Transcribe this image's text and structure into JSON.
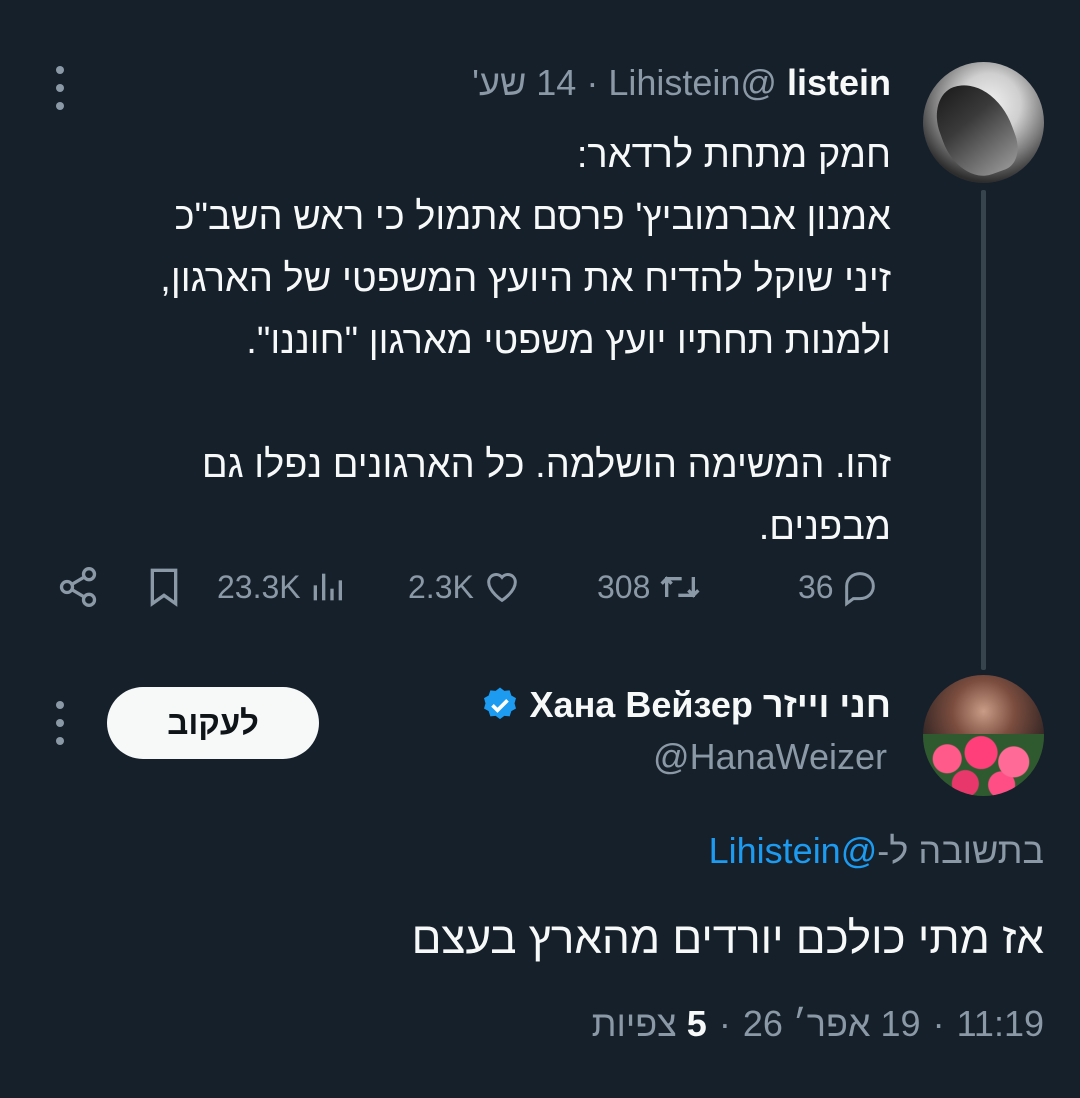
{
  "original_tweet": {
    "display_name": "listein",
    "handle": "@Lihistein",
    "separator": "·",
    "time": "14 שע'",
    "text": "חמק מתחת לרדאר:\nאמנון אברמוביץ' פרסם אתמול כי ראש השב\"כ\nזיני שוקל להדיח את היועץ המשפטי של הארגון,\nולמנות תחתיו יועץ משפטי מארגון \"חוננו\".\n\nזהו. המשימה הושלמה. כל הארגונים נפלו גם\nמבפנים.",
    "actions": {
      "replies": "36",
      "retweets": "308",
      "likes": "2.3K",
      "views": "23.3K"
    }
  },
  "reply_tweet": {
    "display_name": "חני וייזר",
    "display_name_alt": "Хана Вейзер",
    "handle": "@HanaWeizer",
    "follow_label": "לעקוב",
    "reply_to_prefix": "בתשובה ל-",
    "reply_to_handle": "@Lihistein",
    "text": "אז מתי כולכם יורדים מהארץ בעצם",
    "meta": {
      "time": "11:19",
      "date": "19 אפר׳ 26",
      "views_count": "5",
      "views_label": "צפיות",
      "separator": "·"
    }
  },
  "colors": {
    "background": "#15202b",
    "text": "#f7f9f9",
    "muted": "#8b98a5",
    "link": "#1d9bf0",
    "thread_line": "#38444d"
  },
  "icons": [
    "more-icon",
    "reply-icon",
    "retweet-icon",
    "like-icon",
    "views-icon",
    "bookmark-icon",
    "share-icon",
    "verified-badge-icon"
  ]
}
